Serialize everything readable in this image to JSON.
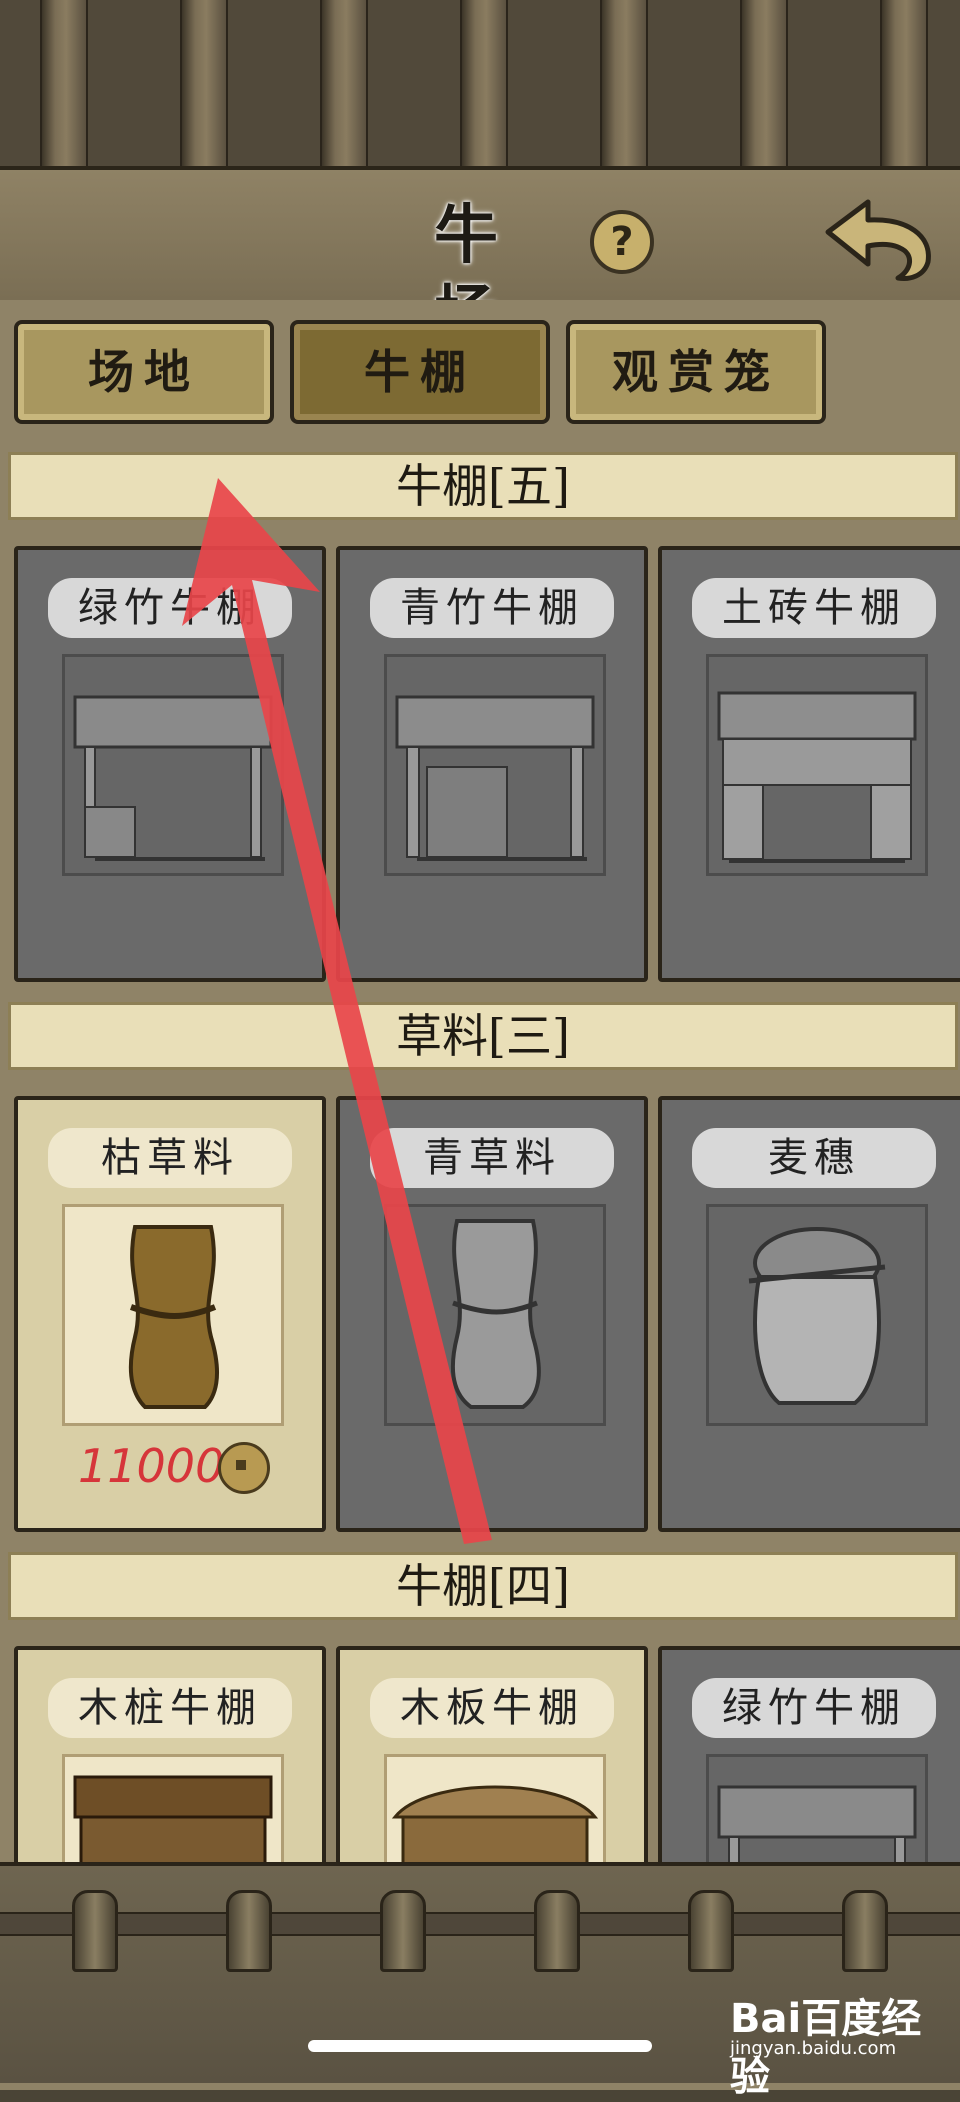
{
  "header": {
    "title": "牛 场",
    "help_symbol": "?"
  },
  "tabs": [
    {
      "label": "场地"
    },
    {
      "label": "牛棚"
    },
    {
      "label": "观赏笼"
    }
  ],
  "sections": [
    {
      "title": "牛棚[五]",
      "cards": [
        {
          "label": "绿竹牛棚",
          "thumb": "shed-bamboo-icon",
          "locked": true
        },
        {
          "label": "青竹牛棚",
          "thumb": "shed-green-bamboo-icon",
          "locked": true
        },
        {
          "label": "土砖牛棚",
          "thumb": "shed-brick-icon",
          "locked": true
        }
      ]
    },
    {
      "title": "草料[三]",
      "cards": [
        {
          "label": "枯草料",
          "thumb": "hay-bundle-icon",
          "locked": false,
          "price": "11000"
        },
        {
          "label": "青草料",
          "thumb": "green-hay-icon",
          "locked": true
        },
        {
          "label": "麦穗",
          "thumb": "wheat-sack-icon",
          "locked": true
        }
      ]
    },
    {
      "title": "牛棚[四]",
      "cards": [
        {
          "label": "木桩牛棚",
          "thumb": "shed-stake-icon",
          "locked": false
        },
        {
          "label": "木板牛棚",
          "thumb": "shed-plank-icon",
          "locked": false
        },
        {
          "label": "绿竹牛棚",
          "thumb": "shed-bamboo-icon",
          "locked": true
        }
      ]
    }
  ],
  "watermark": {
    "logo": "Bai百度经验",
    "url": "jingyan.baidu.com"
  },
  "colors": {
    "annotation_arrow": "#e8454a",
    "price": "#d6353a"
  }
}
